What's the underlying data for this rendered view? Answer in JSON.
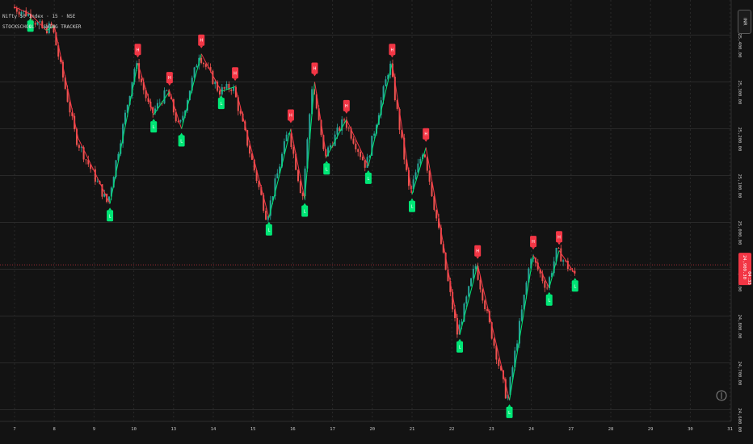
{
  "legend": {
    "symbol": "Nifty 50 Index · 15 · NSE",
    "indicator": "STOCKSCHOOL | SWING TRACKER"
  },
  "top_button": {
    "label": "INR"
  },
  "colors": {
    "background": "#131313",
    "grid": "#2a2a2a",
    "up": "#26a69a",
    "down": "#ef5350",
    "swing_high": "#f23645",
    "swing_low": "#00e676",
    "price_tag": "#f23645"
  },
  "chart_data": {
    "type": "candlestick",
    "title": "",
    "xlabel": "",
    "ylabel": "",
    "x_ticks": [
      "7",
      "8",
      "9",
      "10",
      "13",
      "14",
      "15",
      "16",
      "17",
      "20",
      "21",
      "22",
      "23",
      "24",
      "27",
      "28",
      "29",
      "30",
      "31"
    ],
    "y_ticks": [
      "24,600.00",
      "24,700.00",
      "24,800.00",
      "24,900.00",
      "25,000.00",
      "25,100.00",
      "25,200.00",
      "25,300.00",
      "25,400.00"
    ],
    "ylim": [
      24575,
      25475
    ],
    "y_unit_note": "",
    "last_price": {
      "value": "24,909.30",
      "countdown": "04:33"
    },
    "swing_path": [
      [
        0.0,
        25460
      ],
      [
        0.4,
        25445
      ],
      [
        0.8,
        25410
      ],
      [
        1.0,
        25420
      ],
      [
        1.6,
        25180
      ],
      [
        2.4,
        25040
      ],
      [
        3.1,
        25340
      ],
      [
        3.5,
        25230
      ],
      [
        3.9,
        25280
      ],
      [
        4.2,
        25200
      ],
      [
        4.7,
        25360
      ],
      [
        5.2,
        25280
      ],
      [
        5.55,
        25290
      ],
      [
        6.4,
        25010
      ],
      [
        6.95,
        25200
      ],
      [
        7.3,
        25050
      ],
      [
        7.55,
        25300
      ],
      [
        7.85,
        25140
      ],
      [
        8.35,
        25220
      ],
      [
        8.9,
        25120
      ],
      [
        9.5,
        25340
      ],
      [
        10.0,
        25060
      ],
      [
        10.35,
        25160
      ],
      [
        11.2,
        24760
      ],
      [
        11.65,
        24910
      ],
      [
        12.45,
        24620
      ],
      [
        13.05,
        24930
      ],
      [
        13.45,
        24860
      ],
      [
        13.7,
        24940
      ],
      [
        14.1,
        24890
      ]
    ],
    "swing_highs": [
      {
        "x": 3.1,
        "y": 25340,
        "label": "H"
      },
      {
        "x": 3.9,
        "y": 25280,
        "label": "H"
      },
      {
        "x": 4.7,
        "y": 25360,
        "label": "H"
      },
      {
        "x": 5.55,
        "y": 25290,
        "label": "H"
      },
      {
        "x": 6.95,
        "y": 25200,
        "label": "H"
      },
      {
        "x": 7.55,
        "y": 25300,
        "label": "H"
      },
      {
        "x": 8.35,
        "y": 25220,
        "label": "H"
      },
      {
        "x": 9.5,
        "y": 25340,
        "label": "H"
      },
      {
        "x": 10.35,
        "y": 25160,
        "label": "H"
      },
      {
        "x": 11.65,
        "y": 24910,
        "label": "H"
      },
      {
        "x": 13.05,
        "y": 24930,
        "label": "H"
      },
      {
        "x": 13.7,
        "y": 24940,
        "label": "H"
      }
    ],
    "swing_lows": [
      {
        "x": 0.4,
        "y": 25445,
        "label": "L"
      },
      {
        "x": 2.4,
        "y": 25040,
        "label": "L"
      },
      {
        "x": 3.5,
        "y": 25230,
        "label": "L"
      },
      {
        "x": 4.2,
        "y": 25200,
        "label": "L"
      },
      {
        "x": 5.2,
        "y": 25280,
        "label": "L"
      },
      {
        "x": 6.4,
        "y": 25010,
        "label": "L"
      },
      {
        "x": 7.3,
        "y": 25050,
        "label": "L"
      },
      {
        "x": 7.85,
        "y": 25140,
        "label": "L"
      },
      {
        "x": 8.9,
        "y": 25120,
        "label": "L"
      },
      {
        "x": 10.0,
        "y": 25060,
        "label": "L"
      },
      {
        "x": 11.2,
        "y": 24760,
        "label": "L"
      },
      {
        "x": 12.45,
        "y": 24620,
        "label": "L"
      },
      {
        "x": 13.45,
        "y": 24860,
        "label": "L"
      },
      {
        "x": 14.1,
        "y": 24890,
        "label": "L"
      }
    ],
    "grid": true,
    "legend_position": "top-left"
  }
}
